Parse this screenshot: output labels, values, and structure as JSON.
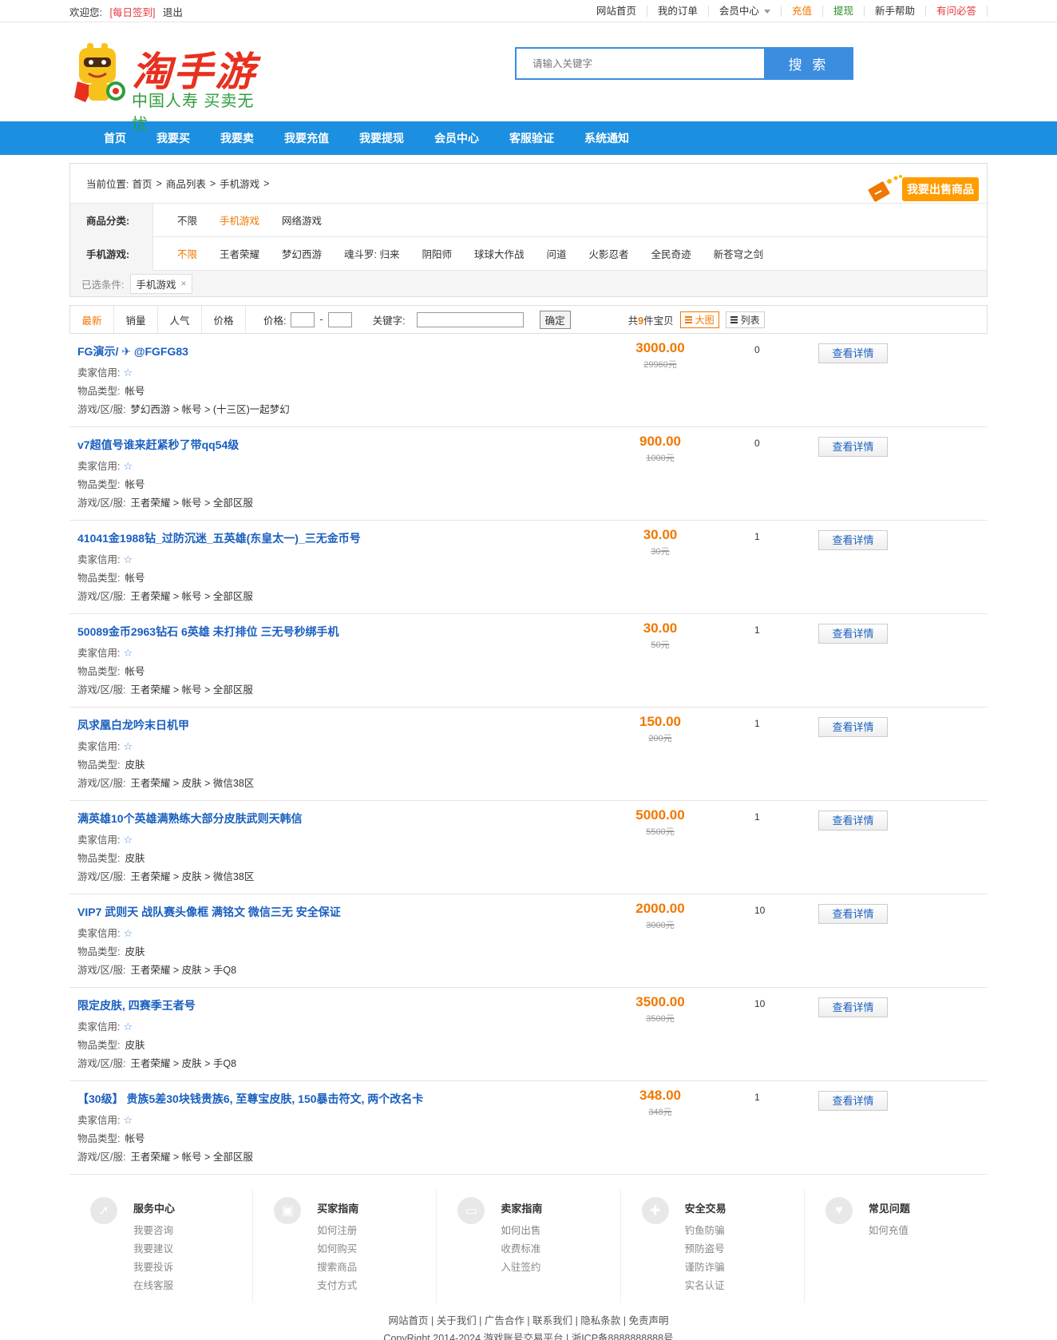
{
  "topbar": {
    "welcome": "欢迎您:",
    "sign_in": "[每日签到]",
    "logout": "退出",
    "links": [
      "网站首页",
      "我的订单",
      "会员中心",
      "充值",
      "提现",
      "新手帮助",
      "有问必答"
    ]
  },
  "header": {
    "logo_text": "淘手游",
    "logo_sub": "中国人寿 买卖无忧",
    "search_placeholder": "请输入关键字",
    "search_button": "搜 索"
  },
  "nav": [
    "首页",
    "我要买",
    "我要卖",
    "我要充值",
    "我要提现",
    "会员中心",
    "客服验证",
    "系统通知"
  ],
  "breadcrumb": {
    "label": "当前位置:",
    "items": [
      "首页",
      "商品列表",
      "手机游戏"
    ],
    "sep": ">",
    "sell_button": "我要出售商品"
  },
  "filters": {
    "category_label": "商品分类:",
    "categories": [
      "不限",
      "手机游戏",
      "网络游戏"
    ],
    "game_label": "手机游戏:",
    "games": [
      "不限",
      "王者荣耀",
      "梦幻西游",
      "魂斗罗: 归来",
      "阴阳师",
      "球球大作战",
      "问道",
      "火影忍者",
      "全民奇迹",
      "新苍穹之剑"
    ],
    "chosen_label": "已选条件:",
    "chosen_chip": "手机游戏",
    "chosen_close": "×"
  },
  "sortbar": {
    "tabs": [
      "最新",
      "销量",
      "人气",
      "价格"
    ],
    "price_label": "价格:",
    "dash": "-",
    "keyword_label": "关键字:",
    "ok": "确定",
    "count_prefix": "共",
    "count": "9",
    "count_suffix": "件宝贝",
    "view_big": "大图",
    "view_list": "列表"
  },
  "labels": {
    "credit": "卖家信用:",
    "type": "物品类型:",
    "server": "游戏/区/服:",
    "detail": "查看详情",
    "star": "☆"
  },
  "items": [
    {
      "title": "FG演示/ ✈ @FGFG83",
      "type": "帐号",
      "server": "梦幻西游 > 帐号 > (十三区)一起梦幻",
      "price": "3000.00",
      "old": "29960元",
      "num": "0"
    },
    {
      "title": "v7超值号谁来赶紧秒了带qq54级",
      "type": "帐号",
      "server": "王者荣耀 > 帐号 > 全部区服",
      "price": "900.00",
      "old": "1000元",
      "num": "0"
    },
    {
      "title": "41041金1988钻_过防沉迷_五英雄(东皇太一)_三无金币号",
      "type": "帐号",
      "server": "王者荣耀 > 帐号 > 全部区服",
      "price": "30.00",
      "old": "30元",
      "num": "1"
    },
    {
      "title": "50089金币2963钻石 6英雄 未打排位 三无号秒绑手机",
      "type": "帐号",
      "server": "王者荣耀 > 帐号 > 全部区服",
      "price": "30.00",
      "old": "50元",
      "num": "1"
    },
    {
      "title": "凤求凰白龙吟末日机甲",
      "type": "皮肤",
      "server": "王者荣耀 > 皮肤 > 微信38区",
      "price": "150.00",
      "old": "200元",
      "num": "1"
    },
    {
      "title": "满英雄10个英雄满熟练大部分皮肤武则天韩信",
      "type": "皮肤",
      "server": "王者荣耀 > 皮肤 > 微信38区",
      "price": "5000.00",
      "old": "5500元",
      "num": "1"
    },
    {
      "title": "VIP7 武则天 战队赛头像框 满铭文 微信三无 安全保证",
      "type": "皮肤",
      "server": "王者荣耀 > 皮肤 > 手Q8",
      "price": "2000.00",
      "old": "3000元",
      "num": "10"
    },
    {
      "title": "限定皮肤, 四赛季王者号",
      "type": "皮肤",
      "server": "王者荣耀 > 皮肤 > 手Q8",
      "price": "3500.00",
      "old": "3500元",
      "num": "10"
    },
    {
      "title": "【30级】 贵族5差30块钱贵族6, 至尊宝皮肤, 150暴击符文, 两个改名卡",
      "type": "帐号",
      "server": "王者荣耀 > 帐号 > 全部区服",
      "price": "348.00",
      "old": "348元",
      "num": "1"
    }
  ],
  "footer": {
    "cols": [
      {
        "title": "服务中心",
        "links": [
          "我要咨询",
          "我要建议",
          "我要投诉",
          "在线客服"
        ]
      },
      {
        "title": "买家指南",
        "links": [
          "如何注册",
          "如何购买",
          "搜索商品",
          "支付方式"
        ]
      },
      {
        "title": "卖家指南",
        "links": [
          "如何出售",
          "收费标准",
          "入驻签约"
        ]
      },
      {
        "title": "安全交易",
        "links": [
          "钓鱼防骗",
          "预防盗号",
          "谨防诈骗",
          "实名认证"
        ]
      },
      {
        "title": "常见问题",
        "links": [
          "如何充值"
        ]
      }
    ],
    "bottom_links": "网站首页 | 关于我们 | 广告合作 | 联系我们 | 隐私条款 | 免责声明",
    "copyright": "CopyRight 2014-2024 游戏账号交易平台 | 浙ICP备8888888888号"
  }
}
